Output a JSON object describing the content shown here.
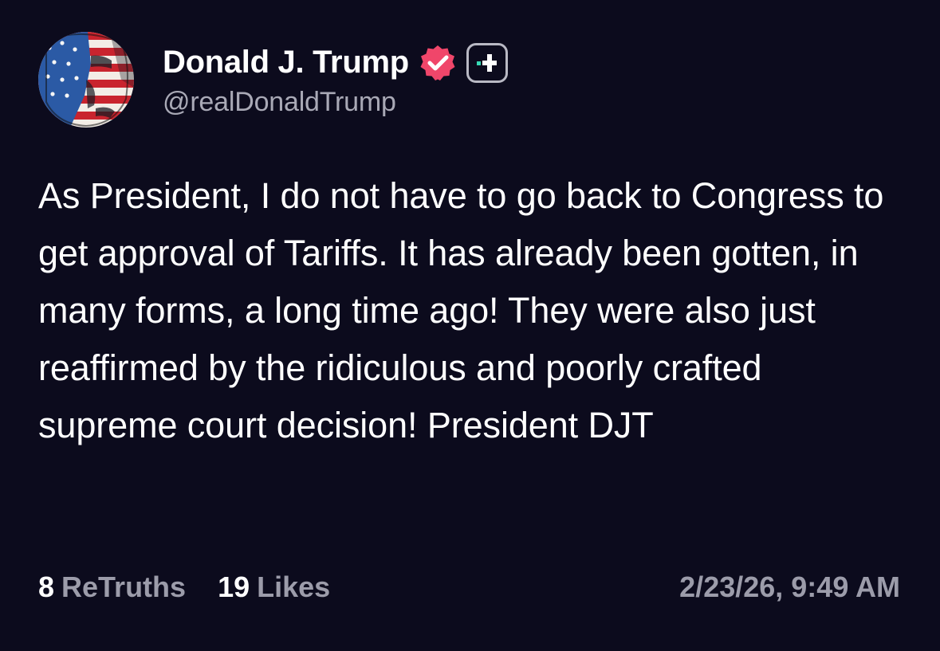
{
  "post": {
    "author": {
      "display_name": "Donald J. Trump",
      "handle": "@realDonaldTrump",
      "avatar_icon": "flag-portrait-avatar",
      "verified_icon": "verified-badge-icon",
      "plus_icon": "plus-badge-icon"
    },
    "text": "As President, I do not have to go back to Congress to get approval of Tariffs. It has already been gotten, in many forms, a long time ago! They were also just reaffirmed by the ridiculous and poorly crafted supreme court decision! President DJT",
    "stats": {
      "retruths_count": "8",
      "retruths_label": "ReTruths",
      "likes_count": "19",
      "likes_label": "Likes"
    },
    "timestamp": "2/23/26, 9:49 AM"
  },
  "colors": {
    "background": "#0c0b1d",
    "text_primary": "#ffffff",
    "text_secondary": "#9c9caa",
    "verified_badge": "#f0466a",
    "plus_accent": "#37d8b4"
  }
}
